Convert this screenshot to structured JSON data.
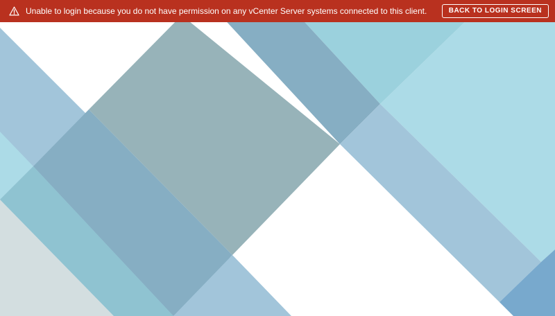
{
  "alert": {
    "icon": "warning-icon",
    "message": "Unable to login because you do not have permission on any vCenter Server systems connected to this client.",
    "button_label": "BACK TO LOGIN SCREEN",
    "color": "#b9311f"
  },
  "background": {
    "colors": [
      "#a2c5da",
      "#97b3b9",
      "#86aec3",
      "#9bd1dd",
      "#acdbe7",
      "#d3dee0",
      "#78a9cd"
    ]
  }
}
